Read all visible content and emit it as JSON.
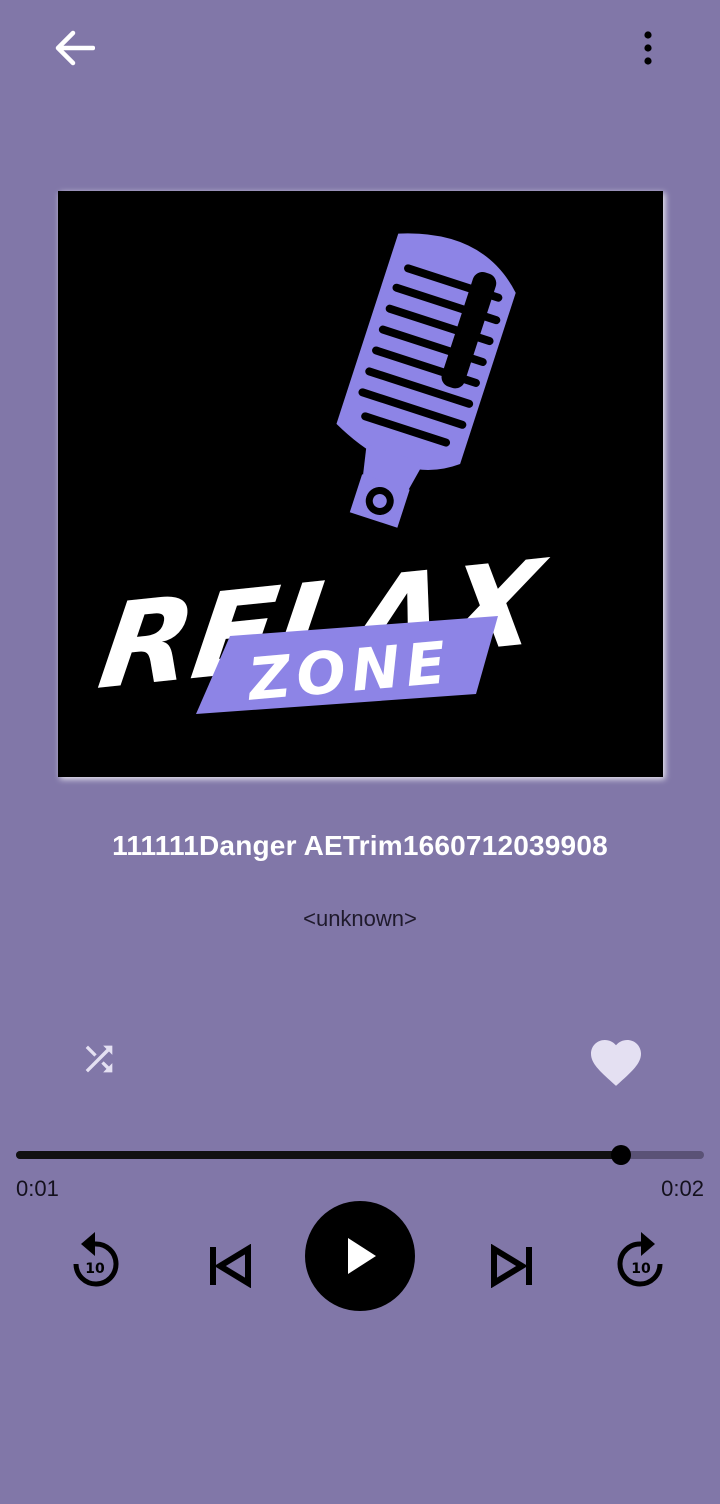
{
  "header": {
    "back_icon": "arrow-left-icon",
    "menu_icon": "more-vertical-icon"
  },
  "artwork": {
    "line1": "RELAX",
    "line2": "ZONE",
    "accent_color": "#8d84e6",
    "background": "#000000"
  },
  "track": {
    "title": "111111Danger AETrim1660712039908",
    "artist": "<unknown>"
  },
  "actions": {
    "shuffle_icon": "shuffle-icon",
    "favorite_icon": "heart-icon",
    "favorite_color": "#e4e0f2"
  },
  "progress": {
    "current": "0:01",
    "total": "0:02",
    "fraction": 0.88
  },
  "controls": {
    "rewind_label": "10",
    "forward_label": "10",
    "play_icon": "play-icon",
    "previous_icon": "skip-previous-icon",
    "next_icon": "skip-next-icon"
  },
  "colors": {
    "background": "#8177a8",
    "title_text": "#ffffff",
    "control": "#000000"
  }
}
